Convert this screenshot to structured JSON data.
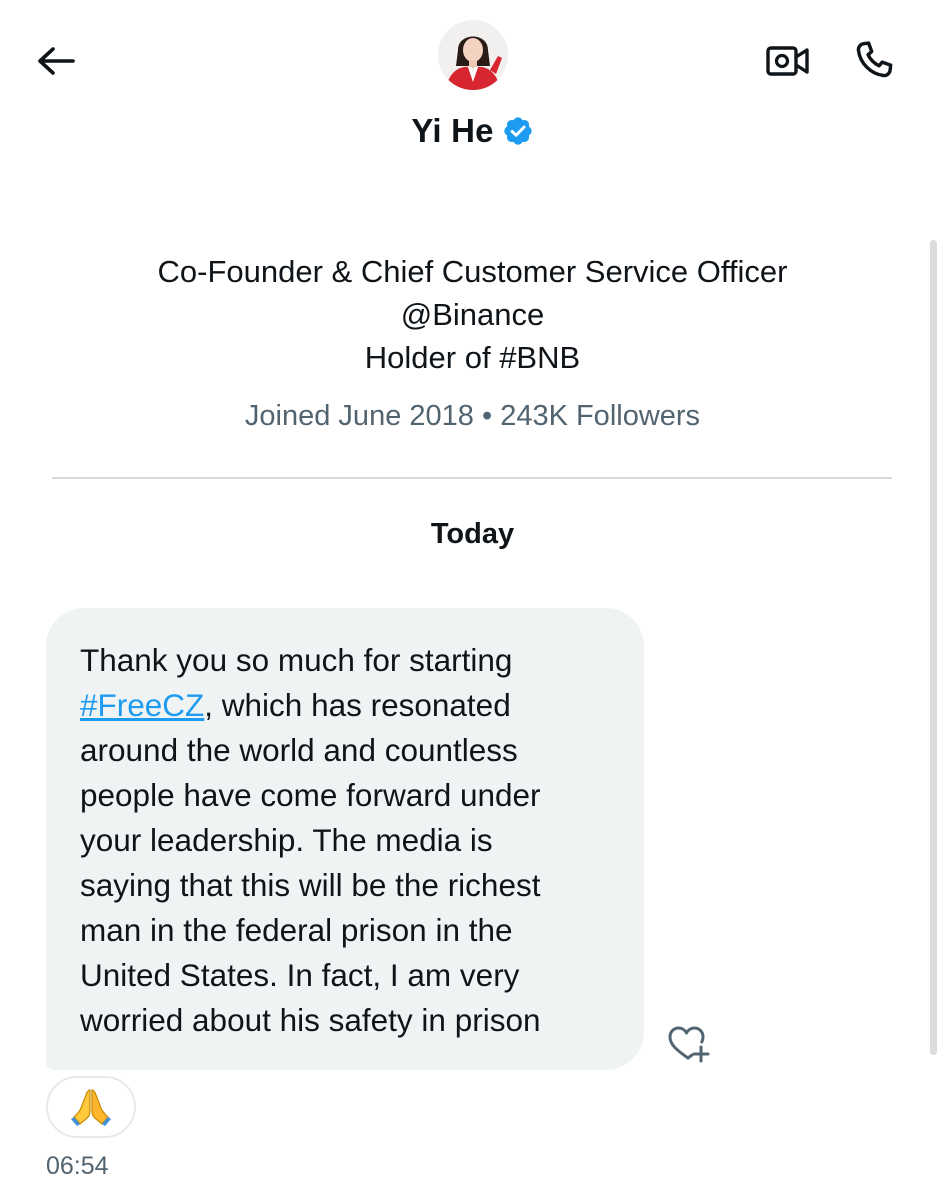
{
  "header": {
    "back_icon": "arrow-left-icon",
    "display_name": "Yi He",
    "verified_icon": "verified-badge-icon",
    "verified_color": "#1d9bf0",
    "video_icon": "video-call-icon",
    "call_icon": "phone-icon"
  },
  "profile": {
    "bio_line1": "Co-Founder & Chief Customer Service Officer",
    "bio_line2": "@Binance",
    "bio_line3": "Holder of #BNB",
    "joined": "Joined June 2018",
    "separator": "•",
    "followers": "243K Followers"
  },
  "conversation": {
    "date_label": "Today",
    "message": {
      "hashtag": "#FreeCZ",
      "lines": [
        "Thank you so much for starting",
        ", which has resonated",
        "around the world and countless",
        "people have come forward under",
        "your leadership. The media is",
        "saying that this will be the richest",
        "man in the federal prison in the",
        "United States. In fact, I am very",
        "worried about his safety in prison"
      ],
      "reaction_emoji": "🙏",
      "add_reaction_icon": "heart-plus-icon",
      "time": "06:54"
    }
  },
  "colors": {
    "accent": "#1d9bf0",
    "bubble": "#eff3f4",
    "muted_text": "#536471"
  }
}
